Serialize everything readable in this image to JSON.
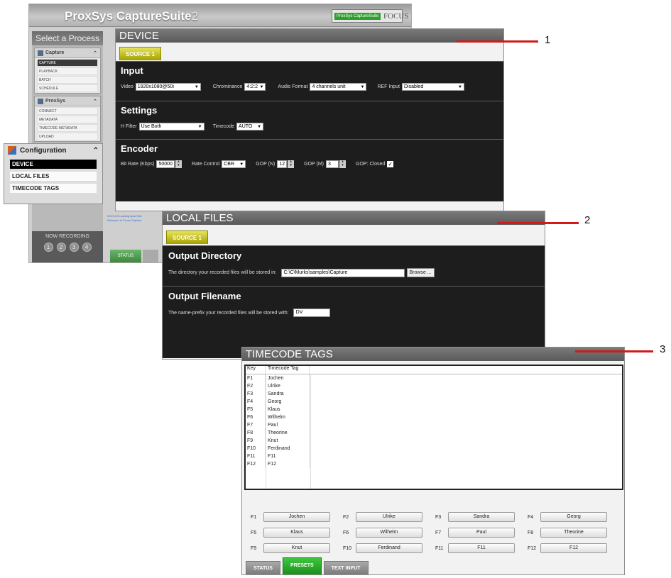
{
  "app": {
    "brand_prefix": "ProxSys",
    "brand_name": "CaptureSuite",
    "brand_version": "2",
    "focus_badge_tag": "ProxSys CaptureSuite",
    "focus_badge_text": "FOCUS"
  },
  "sidebar": {
    "title": "Select a Process",
    "groups": [
      {
        "label": "Capture",
        "items": [
          "CAPTURE",
          "PLAYBACK",
          "BATCH",
          "SCHEDULE"
        ],
        "active": "CAPTURE"
      },
      {
        "label": "ProxSys",
        "items": [
          "CONNECT",
          "METADATA",
          "TIMECODE METADATA",
          "UPLOAD"
        ]
      }
    ],
    "now_recording": "NOW RECORDING",
    "slots": [
      "1",
      "2",
      "3",
      "4"
    ],
    "log_lines": [
      "09:22:29 Loading local Sett",
      "Welcome to Focus Capture"
    ],
    "status_tab": "STATUS"
  },
  "config": {
    "title": "Configuration",
    "items": [
      "DEVICE",
      "LOCAL FILES",
      "TIMECODE TAGS"
    ]
  },
  "device": {
    "title": "DEVICE",
    "tab": "SOURCE 1",
    "input": {
      "heading": "Input",
      "video_label": "Video",
      "video_value": "1920x1080@50i",
      "chroma_label": "Chrominance",
      "chroma_value": "4:2:2",
      "audio_label": "Audio Format",
      "audio_value": "4 channels unit",
      "ref_label": "REF Input",
      "ref_value": "Disabled"
    },
    "settings": {
      "heading": "Settings",
      "hfilter_label": "H Filter",
      "hfilter_value": "Use Both",
      "timecode_label": "Timecode",
      "timecode_value": "AUTO"
    },
    "encoder": {
      "heading": "Encoder",
      "bitrate_label": "Bit Rate (Kbps)",
      "bitrate_value": "50000",
      "ratecontrol_label": "Rate Control",
      "ratecontrol_value": "CBR",
      "gopn_label": "GOP (N)",
      "gopn_value": "12",
      "gopm_label": "GOP (M)",
      "gopm_value": "3",
      "gopclosed_label": "GOP: Closed"
    }
  },
  "local_files": {
    "title": "LOCAL FILES",
    "tab": "SOURCE 1",
    "outdir": {
      "heading": "Output Directory",
      "label": "The directory your recorded files will be stored in:",
      "value": "C:\\C\\Murks\\samples\\Capture",
      "browse": "Browse ..."
    },
    "outfile": {
      "heading": "Output Filename",
      "label": "The name-prefix your recorded files will be stored with:",
      "value": "DV"
    }
  },
  "timecode": {
    "title": "TIMECODE TAGS",
    "col_key": "Key",
    "col_tag": "Timecode Tag",
    "rows": [
      {
        "key": "F1",
        "tag": "Jochen"
      },
      {
        "key": "F2",
        "tag": "Ulrike"
      },
      {
        "key": "F3",
        "tag": "Sandra"
      },
      {
        "key": "F4",
        "tag": "Georg"
      },
      {
        "key": "F5",
        "tag": "Klaus"
      },
      {
        "key": "F6",
        "tag": "Wilhelm"
      },
      {
        "key": "F7",
        "tag": "Paul"
      },
      {
        "key": "F8",
        "tag": "Theorine"
      },
      {
        "key": "F9",
        "tag": "Knut"
      },
      {
        "key": "F10",
        "tag": "Ferdinand"
      },
      {
        "key": "F11",
        "tag": "F11"
      },
      {
        "key": "F12",
        "tag": "F12"
      }
    ],
    "tabs": [
      "STATUS",
      "PRESETS",
      "TEXT INPUT"
    ],
    "active_tab": "PRESETS"
  },
  "callouts": [
    "1",
    "2",
    "3"
  ],
  "colors": {
    "callout_red": "#d21a1a",
    "source_tab": "#c9c400",
    "active_tab_green": "#2aaa2a"
  }
}
